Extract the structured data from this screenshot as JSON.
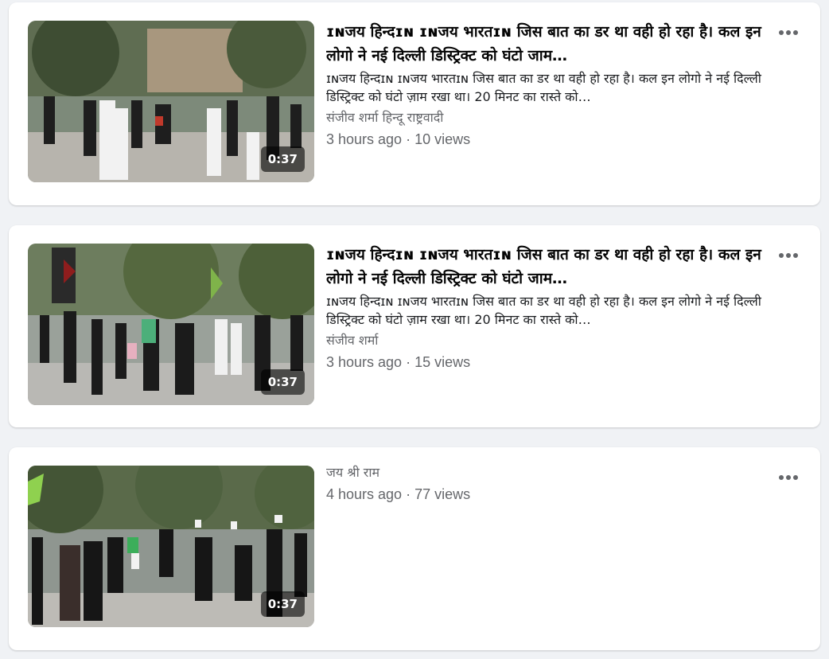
{
  "videos": [
    {
      "duration": "0:37",
      "title": "ɪɴजय हिन्दɪɴ ɪɴजय भारतɪɴ जिस बात का डर था वही हो रहा है। कल इन लोगो ने नई दिल्ली डिस्ट्रिक्ट को घंटो जाम…",
      "description": "ɪɴजय हिन्दɪɴ ɪɴजय भारतɪɴ जिस बात का डर था वही हो रहा है। कल इन लोगो ने नई दिल्ली डिस्ट्रिक्ट को घंटो ज़ाम रखा था। 20 मिनट का रास्ते को…",
      "author": "संजीव शर्मा हिन्दू राष्ट्रवादी",
      "meta": "3 hours ago · 10 views"
    },
    {
      "duration": "0:37",
      "title": "ɪɴजय हिन्दɪɴ ɪɴजय भारतɪɴ जिस बात का डर था वही हो रहा है। कल इन लोगो ने नई दिल्ली डिस्ट्रिक्ट को घंटो जाम…",
      "description": "ɪɴजय हिन्दɪɴ ɪɴजय भारतɪɴ जिस बात का डर था वही हो रहा है। कल इन लोगो ने नई दिल्ली डिस्ट्रिक्ट को घंटो ज़ाम रखा था। 20 मिनट का रास्ते को…",
      "author": "संजीव शर्मा",
      "meta": "3 hours ago · 15 views"
    },
    {
      "duration": "0:37",
      "author": "जय श्री राम",
      "meta": "4 hours ago · 77 views"
    }
  ],
  "icons": {
    "more": "more-options-icon"
  },
  "colors": {
    "background": "#f0f2f5",
    "card": "#ffffff",
    "secondary_text": "#65676b"
  }
}
